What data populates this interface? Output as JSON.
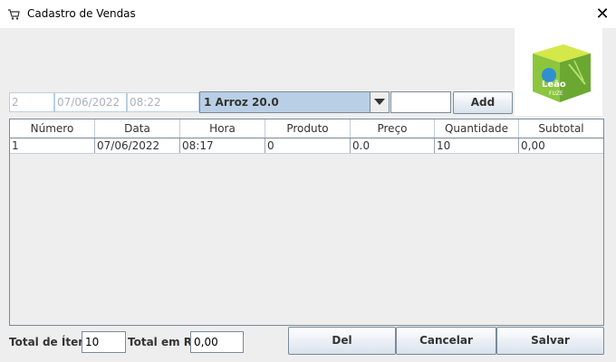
{
  "window": {
    "title": "Cadastro de Vendas",
    "close_glyph": "✕"
  },
  "form": {
    "numero": "2",
    "data": "07/06/2022",
    "hora": "08:22",
    "produto_selected": "1 Arroz 20.0",
    "quantidade": "",
    "add_label": "Add"
  },
  "product_image": {
    "brand_text": "Leão",
    "sub_text": "FUZE"
  },
  "table": {
    "headers": [
      "Número",
      "Data",
      "Hora",
      "Produto",
      "Preço",
      "Quantidade",
      "Subtotal"
    ],
    "rows": [
      [
        "1",
        "07/06/2022",
        "08:17",
        "0",
        "0.0",
        "10",
        "0,00"
      ]
    ]
  },
  "footer": {
    "total_itens_label": "Total de Ítens:",
    "total_itens_value": "10",
    "total_rs_label": "Total em R$:",
    "total_rs_value": "0,00",
    "del_label": "Del",
    "cancelar_label": "Cancelar",
    "salvar_label": "Salvar"
  },
  "colors": {
    "accent": "#b8cfe5",
    "border": "#7a8a99",
    "background": "#eeeeee"
  }
}
